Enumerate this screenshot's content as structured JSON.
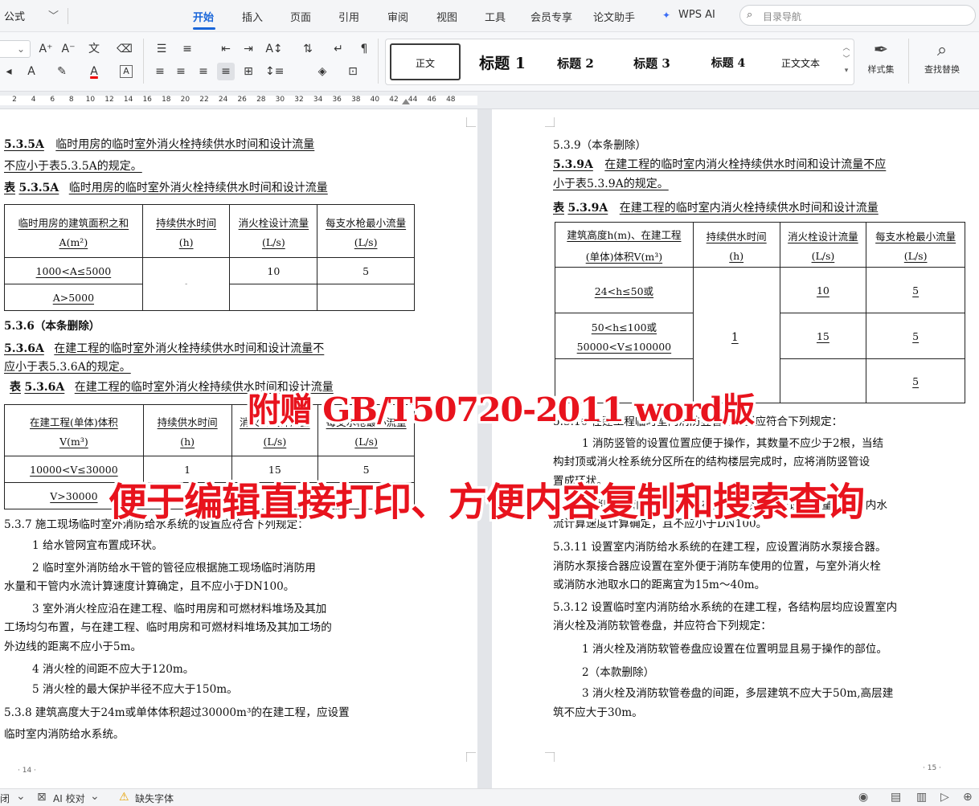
{
  "menubar": {
    "formula": "公式",
    "tabs": [
      "开始",
      "插入",
      "页面",
      "引用",
      "审阅",
      "视图",
      "工具",
      "会员专享",
      "论文助手",
      "WPS AI"
    ],
    "search_placeholder": "目录导航"
  },
  "styles": {
    "normal": "正文",
    "h1": "标题 1",
    "h2": "标题 2",
    "h3": "标题 3",
    "h4": "标题 4",
    "body": "正文文本",
    "style_set": "样式集",
    "find_replace": "查找替换"
  },
  "ruler": [
    "2",
    "4",
    "6",
    "8",
    "10",
    "12",
    "14",
    "16",
    "18",
    "20",
    "22",
    "24",
    "26",
    "28",
    "30",
    "32",
    "34",
    "36",
    "38",
    "40",
    "42",
    "44",
    "46",
    "48"
  ],
  "left_page": {
    "s535a_num": "5.3.5A",
    "s535a_l1": "临时用房的临时室外消火栓持续供水时间和设计流量",
    "s535a_l2": "不应小于表5.3.5A的规定。",
    "t535a_prefix": "表",
    "t535a_num": "5.3.5A",
    "t535a_title": "临时用房的临时室外消火栓持续供水时间和设计流量",
    "t535a_h1a": "临时用房的建筑面积之和",
    "t535a_h1b": "A(m²)",
    "t535a_h2a": "持续供水时间",
    "t535a_h2b": "(h)",
    "t535a_h3a": "消火栓设计流量",
    "t535a_h3b": "(L/s)",
    "t535a_h4a": "每支水枪最小流量",
    "t535a_h4b": "(L/s)",
    "t535a_r1c1": "1000<A≤5000",
    "t535a_r1c2": "-",
    "t535a_r1c3": "10",
    "t535a_r1c4": "5",
    "t535a_r2c1": "A>5000",
    "s536": "5.3.6（本条删除）",
    "s536a_num": "5.3.6A",
    "s536a_l1": "在建工程的临时室外消火栓持续供水时间和设计流量不",
    "s536a_l2": "应小于表5.3.6A的规定。",
    "t536a_prefix": "表",
    "t536a_num": "5.3.6A",
    "t536a_title": "在建工程的临时室外消火栓持续供水时间和设计流量",
    "t536a_h1a": "在建工程(单体)体积",
    "t536a_h1b": "V(m³)",
    "t536a_h2a": "持续供水时间",
    "t536a_h2b": "(h)",
    "t536a_h3a": "消火栓设计流量",
    "t536a_h3b": "(L/s)",
    "t536a_h4a": "每支水枪最小流量",
    "t536a_h4b": "(L/s)",
    "t536a_r1": [
      "10000<V≤30000",
      "1",
      "15",
      "5"
    ],
    "t536a_r2": [
      "V>30000",
      "2",
      "20",
      "5"
    ],
    "s537": "5.3.7  施工现场临时室外消防给水系统的设置应符合下列规定：",
    "p1": "1 给水管网宜布置成环状。",
    "p2a": "2 临时室外消防给水干管的管径应根据施工现场临时消防用",
    "p2b": "水量和干管内水流计算速度计算确定，且不应小于DN100。",
    "p3a": "3 室外消火栓应沿在建工程、临时用房和可燃材料堆场及其加",
    "p3b": "工场均匀布置，与在建工程、临时用房和可燃材料堆场及其加工场的",
    "p3c": "外边线的距离不应小于5m。",
    "p4": "4 消火栓的间距不应大于120m。",
    "p5": "5 消火栓的最大保护半径不应大于150m。",
    "s538a": "5.3.8  建筑高度大于24m或单体体积超过30000m³的在建工程，应设置",
    "s538b": "临时室内消防给水系统。",
    "page_num": "· 14 ·"
  },
  "right_page": {
    "s539": "5.3.9（本条删除）",
    "s539a_num": "5.3.9A",
    "s539a_l1": "在建工程的临时室内消火栓持续供水时间和设计流量不应",
    "s539a_l2": "小于表5.3.9A的规定。",
    "t539a_prefix": "表",
    "t539a_num": "5.3.9A",
    "t539a_title": "在建工程的临时室内消火栓持续供水时间和设计流量",
    "t539a_h1a": "建筑高度h(m)、在建工程",
    "t539a_h1b": "(单体)体积V(m³)",
    "t539a_h2a": "持续供水时间",
    "t539a_h2b": "(h)",
    "t539a_h3a": "消火栓设计流量",
    "t539a_h3b": "(L/s)",
    "t539a_h4a": "每支水枪最小流量",
    "t539a_h4b": "(L/s)",
    "t539a_r1a": "24<h≤50或",
    "t539a_r1c3": "10",
    "t539a_r1c4": "5",
    "t539a_r2a": "50<h≤100或",
    "t539a_r2b": "50000<V≤100000",
    "t539a_r2c2": "1",
    "t539a_r2c3": "15",
    "t539a_r2c4": "5",
    "t539a_r3c4": "5",
    "s5310": "5.3.10 在建工程临时室内消防竖管的设置应符合下列规定：",
    "q1a": "1 消防竖管的设置位置应便于操作，其数量不应少于2根，当结",
    "q1b": "构封顶或消火栓系统分区所在的结构楼层完成时，应将消防竖管设",
    "q1c": "置成环状。",
    "q2a": "2 消防竖管的管径应根据在建工程临时消防设计流量、竖管内水",
    "q2b": "流计算速度计算确定，且不应小于DN100。",
    "s5311a": "5.3.11  设置室内消防给水系统的在建工程，应设置消防水泵接合器。",
    "s5311b": "消防水泵接合器应设置在室外便于消防车使用的位置，与室外消火栓",
    "s5311c": "或消防水池取水口的距离宜为15m～40m。",
    "s5312a": "5.3.12  设置临时室内消防给水系统的在建工程，各结构层均应设置室内",
    "s5312b": "消火栓及消防软管卷盘，并应符合下列规定：",
    "r1": "1 消火栓及消防软管卷盘应设置在位置明显且易于操作的部位。",
    "r2": "2（本款删除）",
    "r3a": "3 消火栓及消防软管卷盘的间距，多层建筑不应大于50m,高层建",
    "r3b": "筑不应大于30m。",
    "page_num": "· 15 ·"
  },
  "watermark": {
    "line1": "附赠 GB/T50720-2011 word版",
    "line2": "便于编辑直接打印、方便内容复制和搜索查询"
  },
  "statusbar": {
    "left": "闭",
    "ai_check": "AI 校对",
    "missing_font": "缺失字体"
  },
  "colors": {
    "accent": "#1a66d9",
    "watermark": "#e8131d"
  }
}
